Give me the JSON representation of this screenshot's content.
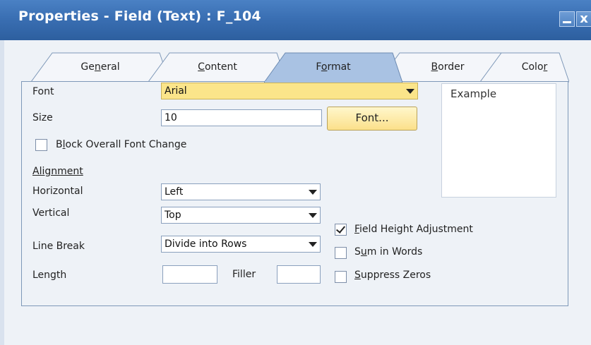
{
  "window": {
    "title": "Properties - Field (Text) : F_104",
    "minimize_label": "",
    "close_label": "x"
  },
  "tabs": [
    {
      "pre": "Ge",
      "key": "n",
      "post": "eral",
      "active": false
    },
    {
      "pre": "",
      "key": "C",
      "post": "ontent",
      "active": false
    },
    {
      "pre": "F",
      "key": "o",
      "post": "rmat",
      "active": true
    },
    {
      "pre": "",
      "key": "B",
      "post": "order",
      "active": false
    },
    {
      "pre": "Colo",
      "key": "r",
      "post": "",
      "active": false
    }
  ],
  "format": {
    "font": {
      "label": "Font",
      "value": "Arial"
    },
    "size": {
      "label": "Size",
      "value": "10"
    },
    "font_button": "Font...",
    "block_font_change": {
      "pre": "B",
      "key": "l",
      "post": "ock Overall Font Change",
      "checked": false
    },
    "alignment_heading": "Alignment",
    "horizontal": {
      "label": "Horizontal",
      "value": "Left"
    },
    "vertical": {
      "label": "Vertical",
      "value": "Top"
    },
    "line_break": {
      "label": "Line Break",
      "value": "Divide into Rows"
    },
    "length": {
      "label": "Length",
      "value": ""
    },
    "filler": {
      "label": "Filler",
      "value": ""
    },
    "field_height": {
      "pre": "",
      "key": "F",
      "post": "ield Height Adjustment",
      "checked": true
    },
    "sum_in_words": {
      "pre": "S",
      "key": "u",
      "post": "m in Words",
      "checked": false
    },
    "suppress_zeros": {
      "pre": "",
      "key": "S",
      "post": "uppress Zeros",
      "checked": false
    },
    "example": "Example"
  },
  "colors": {
    "title_bar": "#3a6fb3",
    "active_tab": "#a9c2e3",
    "inactive_tab": "#f4f6fa",
    "highlight_field": "#fbe58a"
  }
}
